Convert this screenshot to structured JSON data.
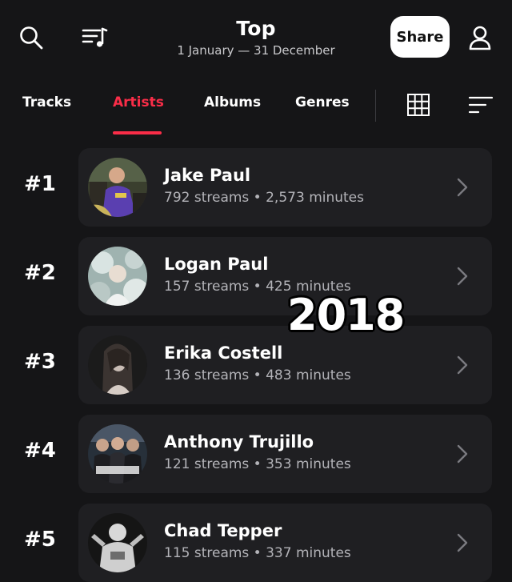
{
  "header": {
    "title": "Top",
    "date_range": "1 January — 31 December",
    "share_label": "Share",
    "icons": {
      "search": "search-icon",
      "playlist": "playlist-icon",
      "profile": "profile-icon"
    }
  },
  "tabs": {
    "items": [
      {
        "label": "Tracks",
        "active": false
      },
      {
        "label": "Artists",
        "active": true
      },
      {
        "label": "Albums",
        "active": false
      },
      {
        "label": "Genres",
        "active": false
      }
    ],
    "accent_color": "#fa2d48",
    "icons": {
      "grid": "grid-view-icon",
      "sort": "sort-icon"
    }
  },
  "artists": [
    {
      "rank": "#1",
      "name": "Jake Paul",
      "stats": "792 streams • 2,573 minutes"
    },
    {
      "rank": "#2",
      "name": "Logan Paul",
      "stats": "157 streams • 425 minutes"
    },
    {
      "rank": "#3",
      "name": "Erika Costell",
      "stats": "136 streams • 483 minutes"
    },
    {
      "rank": "#4",
      "name": "Anthony Trujillo",
      "stats": "121 streams • 353 minutes"
    },
    {
      "rank": "#5",
      "name": "Chad Tepper",
      "stats": "115 streams • 337 minutes"
    }
  ],
  "overlay": {
    "year": "2018"
  },
  "colors": {
    "background": "#151517",
    "card": "#1f1f22",
    "muted_text": "#b3b3b8"
  }
}
